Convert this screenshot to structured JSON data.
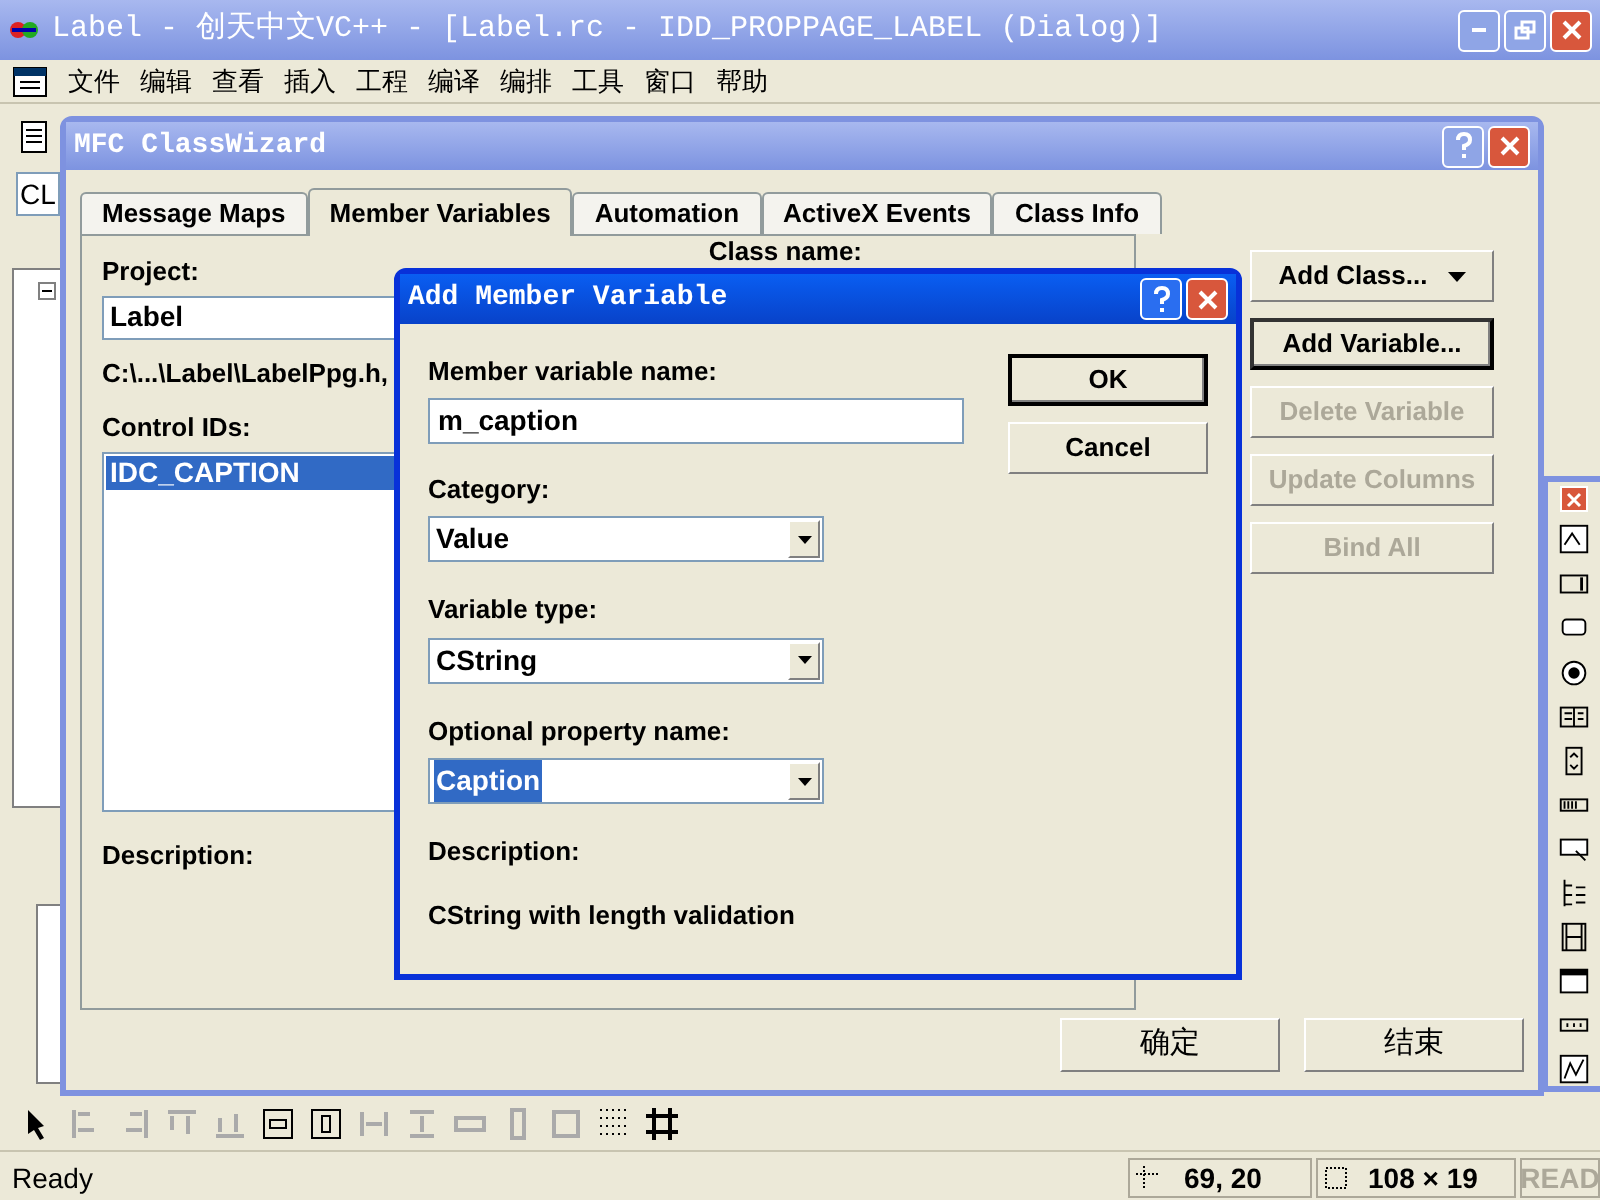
{
  "main_window": {
    "title": "Label - 创天中文VC++ - [Label.rc - IDD_PROPPAGE_LABEL (Dialog)]"
  },
  "menu_bar": [
    "文件",
    "编辑",
    "查看",
    "插入",
    "工程",
    "编译",
    "编排",
    "工具",
    "窗口",
    "帮助"
  ],
  "toolbar_combo": {
    "value": "CL"
  },
  "class_wizard": {
    "title": "MFC ClassWizard",
    "tabs": [
      {
        "label": "Message Maps",
        "selected": false
      },
      {
        "label": "Member Variables",
        "selected": true
      },
      {
        "label": "Automation",
        "selected": false
      },
      {
        "label": "ActiveX Events",
        "selected": false
      },
      {
        "label": "Class Info",
        "selected": false
      }
    ],
    "project_label": "Project:",
    "project_value": "Label",
    "class_name_label": "Class name:",
    "file_path": "C:\\...\\Label\\LabelPpg.h,",
    "control_ids_label": "Control IDs:",
    "control_ids": [
      {
        "label": "IDC_CAPTION",
        "selected": true
      }
    ],
    "description_label": "Description:",
    "buttons": [
      {
        "label": "Add Class...",
        "kind": "dropdown",
        "disabled": false,
        "default": false
      },
      {
        "label": "Add Variable...",
        "kind": "plain",
        "disabled": false,
        "default": true
      },
      {
        "label": "Delete Variable",
        "kind": "plain",
        "disabled": true,
        "default": false
      },
      {
        "label": "Update Columns",
        "kind": "plain",
        "disabled": true,
        "default": false
      },
      {
        "label": "Bind All",
        "kind": "plain",
        "disabled": true,
        "default": false
      }
    ],
    "footer_buttons": [
      "确定",
      "结束"
    ]
  },
  "add_member_variable": {
    "title": "Add Member Variable",
    "fields": [
      {
        "kind": "text",
        "label": "Member variable name:",
        "value": "m_caption",
        "text_selected": false
      },
      {
        "kind": "select",
        "label": "Category:",
        "value": "Value",
        "text_selected": false
      },
      {
        "kind": "select",
        "label": "Variable type:",
        "value": "CString",
        "text_selected": false
      },
      {
        "kind": "select",
        "label": "Optional property name:",
        "value": "Caption",
        "text_selected": true
      }
    ],
    "description_label": "Description:",
    "description": "CString with length validation",
    "buttons": [
      {
        "label": "OK",
        "default": true
      },
      {
        "label": "Cancel",
        "default": false
      }
    ]
  },
  "status_bar": {
    "message": "Ready",
    "position": "69, 20",
    "size": "108 × 19",
    "read_indicator": {
      "label": "READ",
      "disabled": true
    }
  }
}
